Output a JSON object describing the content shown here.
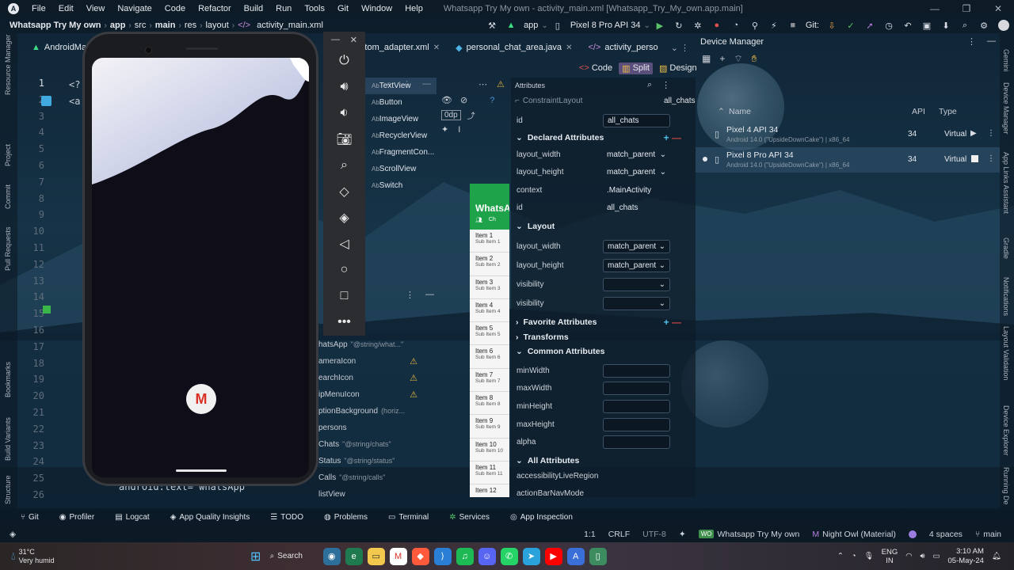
{
  "menu": {
    "app_icon": "android-studio-icon",
    "items": [
      "File",
      "Edit",
      "View",
      "Navigate",
      "Code",
      "Refactor",
      "Build",
      "Run",
      "Tools",
      "Git",
      "Window",
      "Help"
    ],
    "window_title": "Whatsapp Try My own - activity_main.xml [Whatsapp_Try_My_own.app.main]"
  },
  "breadcrumbs": [
    "Whatsapp Try My own",
    "app",
    "src",
    "main",
    "res",
    "layout",
    "activity_main.xml"
  ],
  "toolbar": {
    "run_config": "app",
    "device": "Pixel 8 Pro API 34",
    "git_label": "Git:"
  },
  "tabs": [
    {
      "label": "AndroidMani",
      "icon": "android-icon"
    },
    {
      "label": "y_custom_adapter.xml",
      "icon": "xml-icon"
    },
    {
      "label": "personal_chat_area.java",
      "icon": "java-icon"
    },
    {
      "label": "activity_perso",
      "icon": "xml-icon"
    }
  ],
  "view_modes": {
    "code": "Code",
    "split": "Split",
    "design": "Design"
  },
  "line_numbers": [
    "1",
    "2",
    "3",
    "4",
    "5",
    "6",
    "7",
    "8",
    "9",
    "10",
    "11",
    "12",
    "13",
    "14",
    "15",
    "16",
    "17",
    "18",
    "19",
    "20",
    "21",
    "22",
    "23",
    "24",
    "25",
    "26"
  ],
  "code_snippets": {
    "line1": "<?",
    "line2": "<a",
    "line26": "android:text=\"whatsApp\""
  },
  "emulator_buttons": [
    "power-icon",
    "volume-up-icon",
    "volume-down-icon",
    "camera-icon",
    "zoom-icon",
    "rotate-left-icon",
    "rotate-right-icon",
    "back-icon",
    "home-icon",
    "overview-icon",
    "more-icon"
  ],
  "palette_items": [
    "TextView",
    "Button",
    "ImageView",
    "RecyclerView",
    "FragmentCon...",
    "ScrollView",
    "Switch"
  ],
  "design_tools": {
    "dp": "0dp"
  },
  "component_tree": [
    {
      "label": "hatsApp",
      "hint": "\"@string/what...\"",
      "warn": false
    },
    {
      "label": "ameraIcon",
      "hint": "",
      "warn": true
    },
    {
      "label": "earchIcon",
      "hint": "",
      "warn": true
    },
    {
      "label": "ipMenuIcon",
      "hint": "",
      "warn": true
    },
    {
      "label": "ptionBackground",
      "hint": "(horiz...",
      "warn": false
    },
    {
      "label": "persons",
      "hint": "",
      "warn": false
    },
    {
      "label": "Chats",
      "hint": "\"@string/chats\"",
      "warn": false
    },
    {
      "label": "Status",
      "hint": "\"@string/status\"",
      "warn": false
    },
    {
      "label": "Calls",
      "hint": "\"@string/calls\"",
      "warn": false
    },
    {
      "label": "listView",
      "hint": "",
      "warn": false
    }
  ],
  "preview": {
    "app_title": "WhatsA",
    "tab_label": "Ch",
    "items": [
      {
        "title": "Item 1",
        "sub": "Sub Item 1"
      },
      {
        "title": "Item 2",
        "sub": "Sub Item 2"
      },
      {
        "title": "Item 3",
        "sub": "Sub Item 3"
      },
      {
        "title": "Item 4",
        "sub": "Sub Item 4"
      },
      {
        "title": "Item 5",
        "sub": "Sub Item 5"
      },
      {
        "title": "Item 6",
        "sub": "Sub Item 6"
      },
      {
        "title": "Item 7",
        "sub": "Sub Item 7"
      },
      {
        "title": "Item 8",
        "sub": "Sub Item 8"
      },
      {
        "title": "Item 9",
        "sub": "Sub Item 9"
      },
      {
        "title": "Item 10",
        "sub": "Sub Item 10"
      },
      {
        "title": "Item 11",
        "sub": "Sub Item 11"
      },
      {
        "title": "Item 12",
        "sub": ""
      }
    ]
  },
  "attributes": {
    "header": "Attributes",
    "component": "ConstraintLayout",
    "component_id": "all_chats",
    "id_label": "id",
    "id_value": "all_chats",
    "declared_title": "Declared Attributes",
    "declared": [
      {
        "key": "layout_width",
        "value": "match_parent"
      },
      {
        "key": "layout_height",
        "value": "match_parent"
      },
      {
        "key": "context",
        "value": ".MainActivity"
      },
      {
        "key": "id",
        "value": "all_chats"
      }
    ],
    "layout_title": "Layout",
    "layout": [
      {
        "key": "layout_width",
        "value": "match_parent"
      },
      {
        "key": "layout_height",
        "value": "match_parent"
      },
      {
        "key": "visibility",
        "value": ""
      },
      {
        "key": "visibility",
        "value": ""
      }
    ],
    "favorite_title": "Favorite Attributes",
    "transforms_title": "Transforms",
    "common_title": "Common Attributes",
    "common": [
      "minWidth",
      "maxWidth",
      "minHeight",
      "maxHeight",
      "alpha"
    ],
    "all_title": "All Attributes",
    "all": [
      "accessibilityLiveRegion",
      "actionBarNavMode"
    ]
  },
  "device_manager": {
    "title": "Device Manager",
    "col_name": "Name",
    "col_api": "API",
    "col_type": "Type",
    "devices": [
      {
        "name": "Pixel 4 API 34",
        "sub": "Android 14.0 (\"UpsideDownCake\") | x86_64",
        "api": "34",
        "type": "Virtual",
        "running": false
      },
      {
        "name": "Pixel 8 Pro API 34",
        "sub": "Android 14.0 (\"UpsideDownCake\") | x86_64",
        "api": "34",
        "type": "Virtual",
        "running": true
      }
    ]
  },
  "left_strip": [
    "Resource Manager",
    "Project",
    "Commit",
    "Pull Requests",
    "Bookmarks",
    "Build Variants",
    "Structure"
  ],
  "right_strip": [
    "Gemini",
    "Device Manager",
    "App Links Assistant",
    "Gradle",
    "Notifications",
    "Layout Validation",
    "Device Explorer",
    "Running De"
  ],
  "tool_windows": [
    "Git",
    "Profiler",
    "Logcat",
    "App Quality Insights",
    "TODO",
    "Problems",
    "Terminal",
    "Services",
    "App Inspection"
  ],
  "status": {
    "position": "1:1",
    "line_sep": "CRLF",
    "encoding": "UTF-8",
    "project_badge": "WO",
    "project": "Whatsapp Try My own",
    "theme": "Night Owl (Material)",
    "indent": "4 spaces",
    "branch": "main"
  },
  "taskbar": {
    "temp": "31°C",
    "weather": "Very humid",
    "search": "Search",
    "lang1": "ENG",
    "lang2": "IN",
    "time": "3:10 AM",
    "date": "05-May-24"
  }
}
